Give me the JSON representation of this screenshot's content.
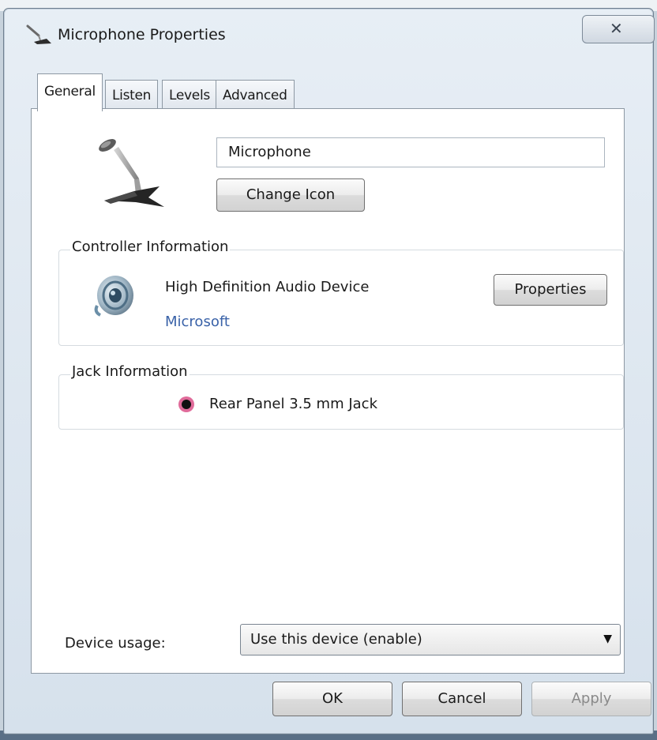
{
  "window": {
    "title": "Microphone Properties",
    "close_label": "✕",
    "icon": "microphone-small-icon"
  },
  "tabs": [
    {
      "label": "General",
      "active": true
    },
    {
      "label": "Listen",
      "active": false
    },
    {
      "label": "Levels",
      "active": false
    },
    {
      "label": "Advanced",
      "active": false
    }
  ],
  "general": {
    "device_icon": "microphone-icon",
    "device_name": "Microphone",
    "change_icon_label": "Change Icon"
  },
  "controller": {
    "group_title": "Controller Information",
    "icon": "speaker-icon",
    "device_name": "High Definition Audio Device",
    "manufacturer": "Microsoft",
    "properties_label": "Properties"
  },
  "jack": {
    "group_title": "Jack Information",
    "icon": "jack-dot-icon",
    "label": "Rear Panel 3.5 mm Jack",
    "color": "#e06b9a"
  },
  "device_usage": {
    "label": "Device usage:",
    "selected": "Use this device (enable)"
  },
  "buttons": {
    "ok": "OK",
    "cancel": "Cancel",
    "apply": "Apply"
  },
  "colors": {
    "link": "#3a62a8",
    "disabled_text": "#8a8a8a"
  }
}
